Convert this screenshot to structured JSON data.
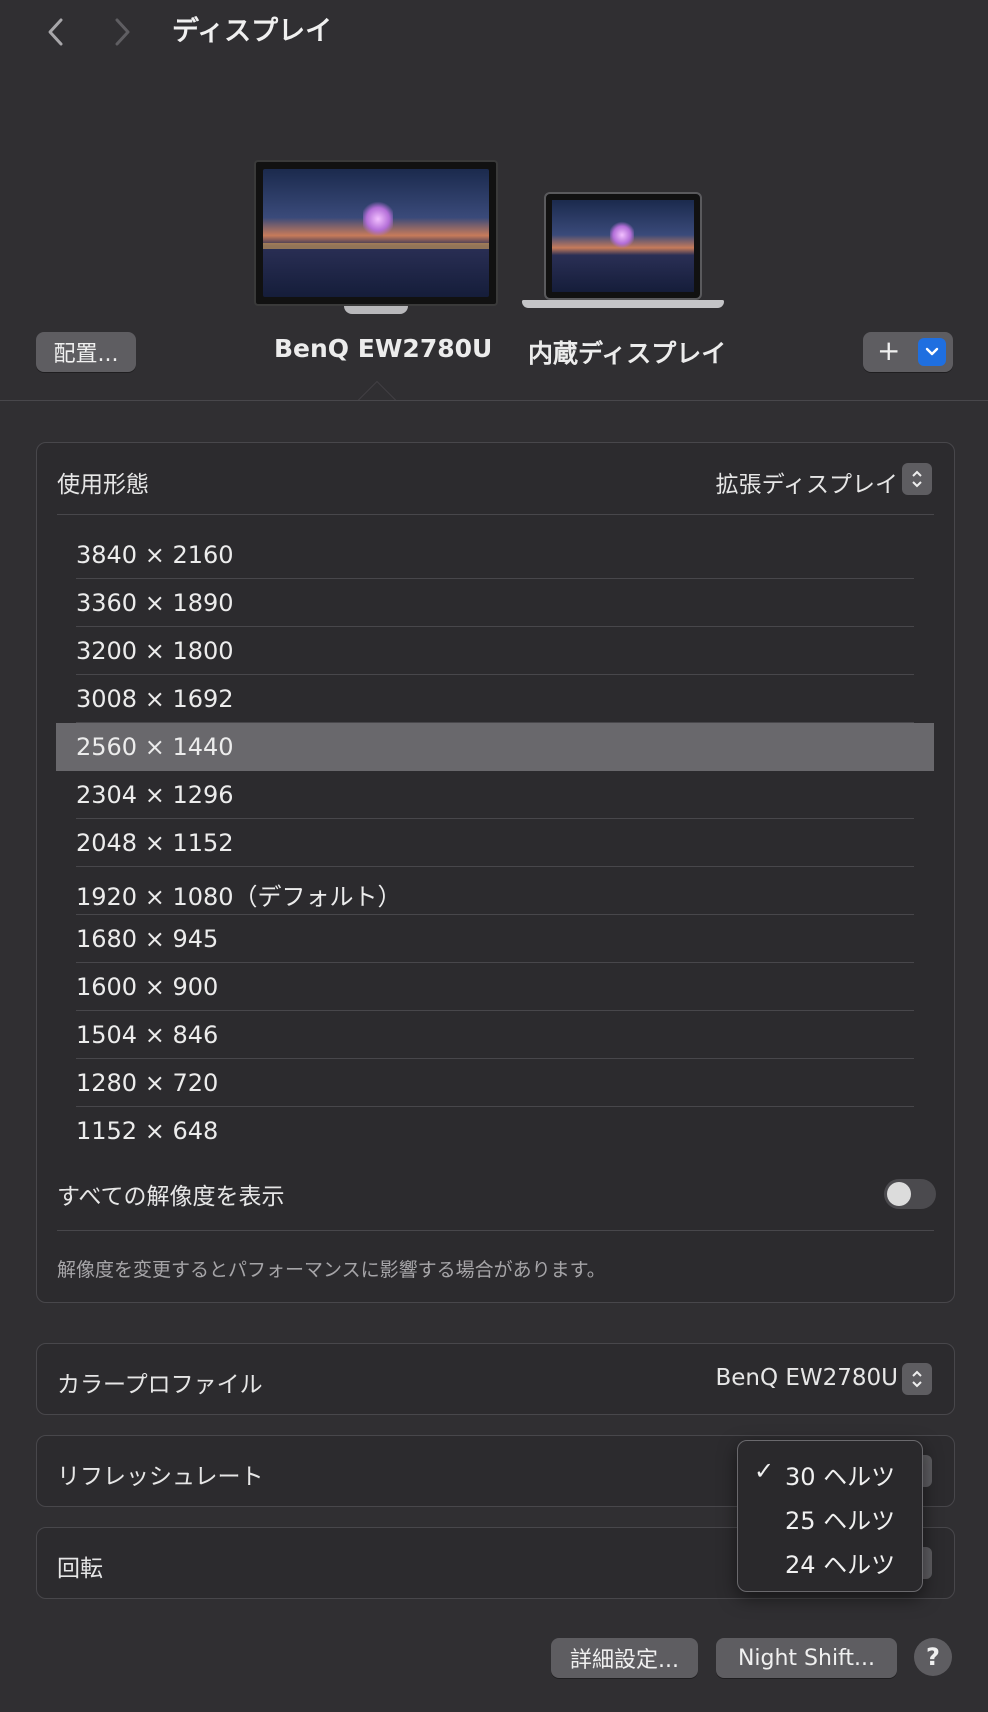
{
  "window": {
    "title": "ディスプレイ"
  },
  "nav": {
    "back_icon": "chevron-left-icon",
    "forward_icon": "chevron-right-icon"
  },
  "arrangement": {
    "arrange_button": "配置...",
    "displays": [
      {
        "name": "BenQ EW2780U",
        "selected": true
      },
      {
        "name": "内蔵ディスプレイ",
        "selected": false
      }
    ],
    "add_button_icon": "plus-icon",
    "add_dropdown_icon": "chevron-down-icon",
    "accent_color": "#1f6fe0"
  },
  "usage": {
    "label": "使用形態",
    "value": "拡張ディスプレイ"
  },
  "resolutions": {
    "items": [
      "3840 × 2160",
      "3360 × 1890",
      "3200 × 1800",
      "3008 × 1692",
      "2560 × 1440",
      "2304 × 1296",
      "2048 × 1152",
      "1920 × 1080（デフォルト）",
      "1680 × 945",
      "1600 × 900",
      "1504 × 846",
      "1280 × 720",
      "1152 × 648"
    ],
    "selected": "2560 × 1440",
    "show_all_label": "すべての解像度を表示",
    "show_all_on": false,
    "note": "解像度を変更するとパフォーマンスに影響する場合があります。"
  },
  "color_profile": {
    "label": "カラープロファイル",
    "value": "BenQ EW2780U"
  },
  "refresh_rate": {
    "label": "リフレッシュレート",
    "menu": [
      {
        "label": "30 ヘルツ",
        "checked": true
      },
      {
        "label": "25 ヘルツ",
        "checked": false
      },
      {
        "label": "24 ヘルツ",
        "checked": false
      }
    ]
  },
  "rotation": {
    "label": "回転"
  },
  "footer": {
    "advanced_button": "詳細設定...",
    "night_shift_button": "Night Shift...",
    "help_button": "?"
  }
}
